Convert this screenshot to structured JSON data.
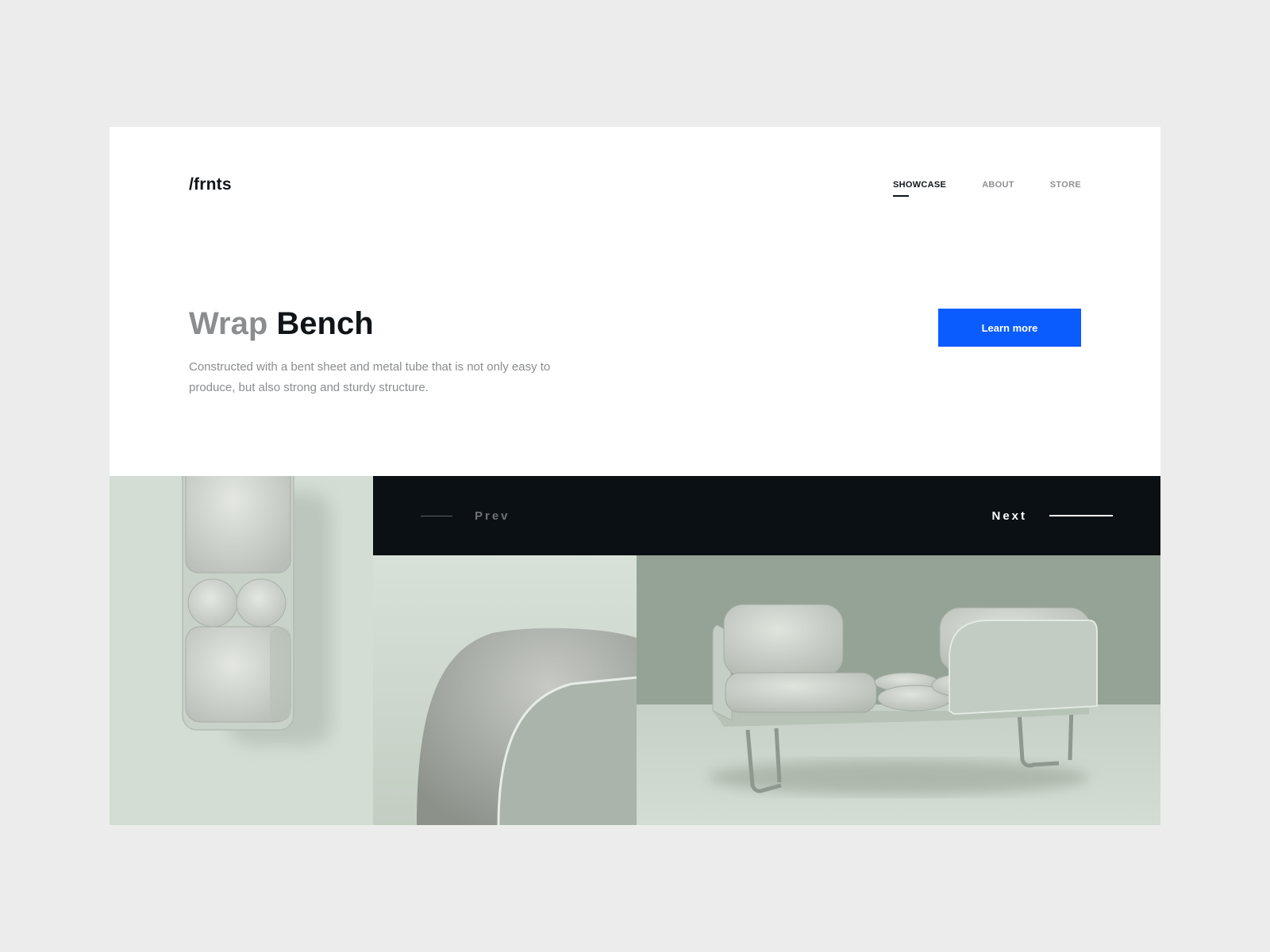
{
  "brand": {
    "logo": "/frnts"
  },
  "nav": {
    "items": [
      {
        "label": "SHOWCASE",
        "active": true
      },
      {
        "label": "ABOUT",
        "active": false
      },
      {
        "label": "STORE",
        "active": false
      }
    ]
  },
  "hero": {
    "title_light": "Wrap",
    "title_bold": "Bench",
    "description": "Constructed with a bent sheet and metal tube that is not only easy to produce, but also strong and sturdy structure.",
    "cta_label": "Learn more"
  },
  "slider": {
    "prev_label": "Prev",
    "next_label": "Next"
  },
  "colors": {
    "accent": "#0a5cff",
    "dark_bar": "#0b1014",
    "background": "#ececec",
    "sage_light": "#d4ddd4",
    "sage_dark": "#95a296"
  },
  "gallery": {
    "images": [
      {
        "name": "bench-top-view"
      },
      {
        "name": "bench-armrest-detail"
      },
      {
        "name": "bench-perspective-view"
      }
    ]
  }
}
